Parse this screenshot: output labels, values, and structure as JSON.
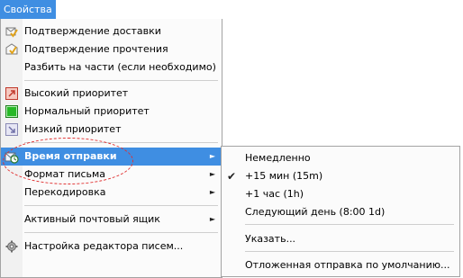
{
  "menubar": {
    "title": "Свойства"
  },
  "menu": {
    "items": [
      {
        "label": "Подтверждение доставки",
        "icon": "delivery-receipt-icon"
      },
      {
        "label": "Подтверждение прочтения",
        "icon": "read-receipt-icon"
      },
      {
        "label": "Разбить на части (если необходимо)",
        "icon": ""
      },
      {
        "label": "Высокий приоритет",
        "icon": "high-priority-icon"
      },
      {
        "label": "Нормальный приоритет",
        "icon": "normal-priority-icon"
      },
      {
        "label": "Низкий приоритет",
        "icon": "low-priority-icon"
      },
      {
        "label": "Время отправки",
        "icon": "send-time-icon",
        "highlighted": true
      },
      {
        "label": "Формат письма",
        "icon": ""
      },
      {
        "label": "Перекодировка",
        "icon": ""
      },
      {
        "label": "Активный почтовый ящик",
        "icon": ""
      },
      {
        "label": "Настройка редактора писем...",
        "icon": "gear-icon"
      }
    ]
  },
  "submenu": {
    "items": [
      {
        "label": "Немедленно"
      },
      {
        "label": "+15 мин (15m)",
        "checked": true
      },
      {
        "label": "+1 час (1h)"
      },
      {
        "label": "Следующий день (8:00 1d)"
      },
      {
        "label": "Указать..."
      },
      {
        "label": "Отложенная отправка по умолчанию..."
      }
    ]
  },
  "colors": {
    "highlight": "#3f8ee2",
    "annotation": "#e03030"
  }
}
